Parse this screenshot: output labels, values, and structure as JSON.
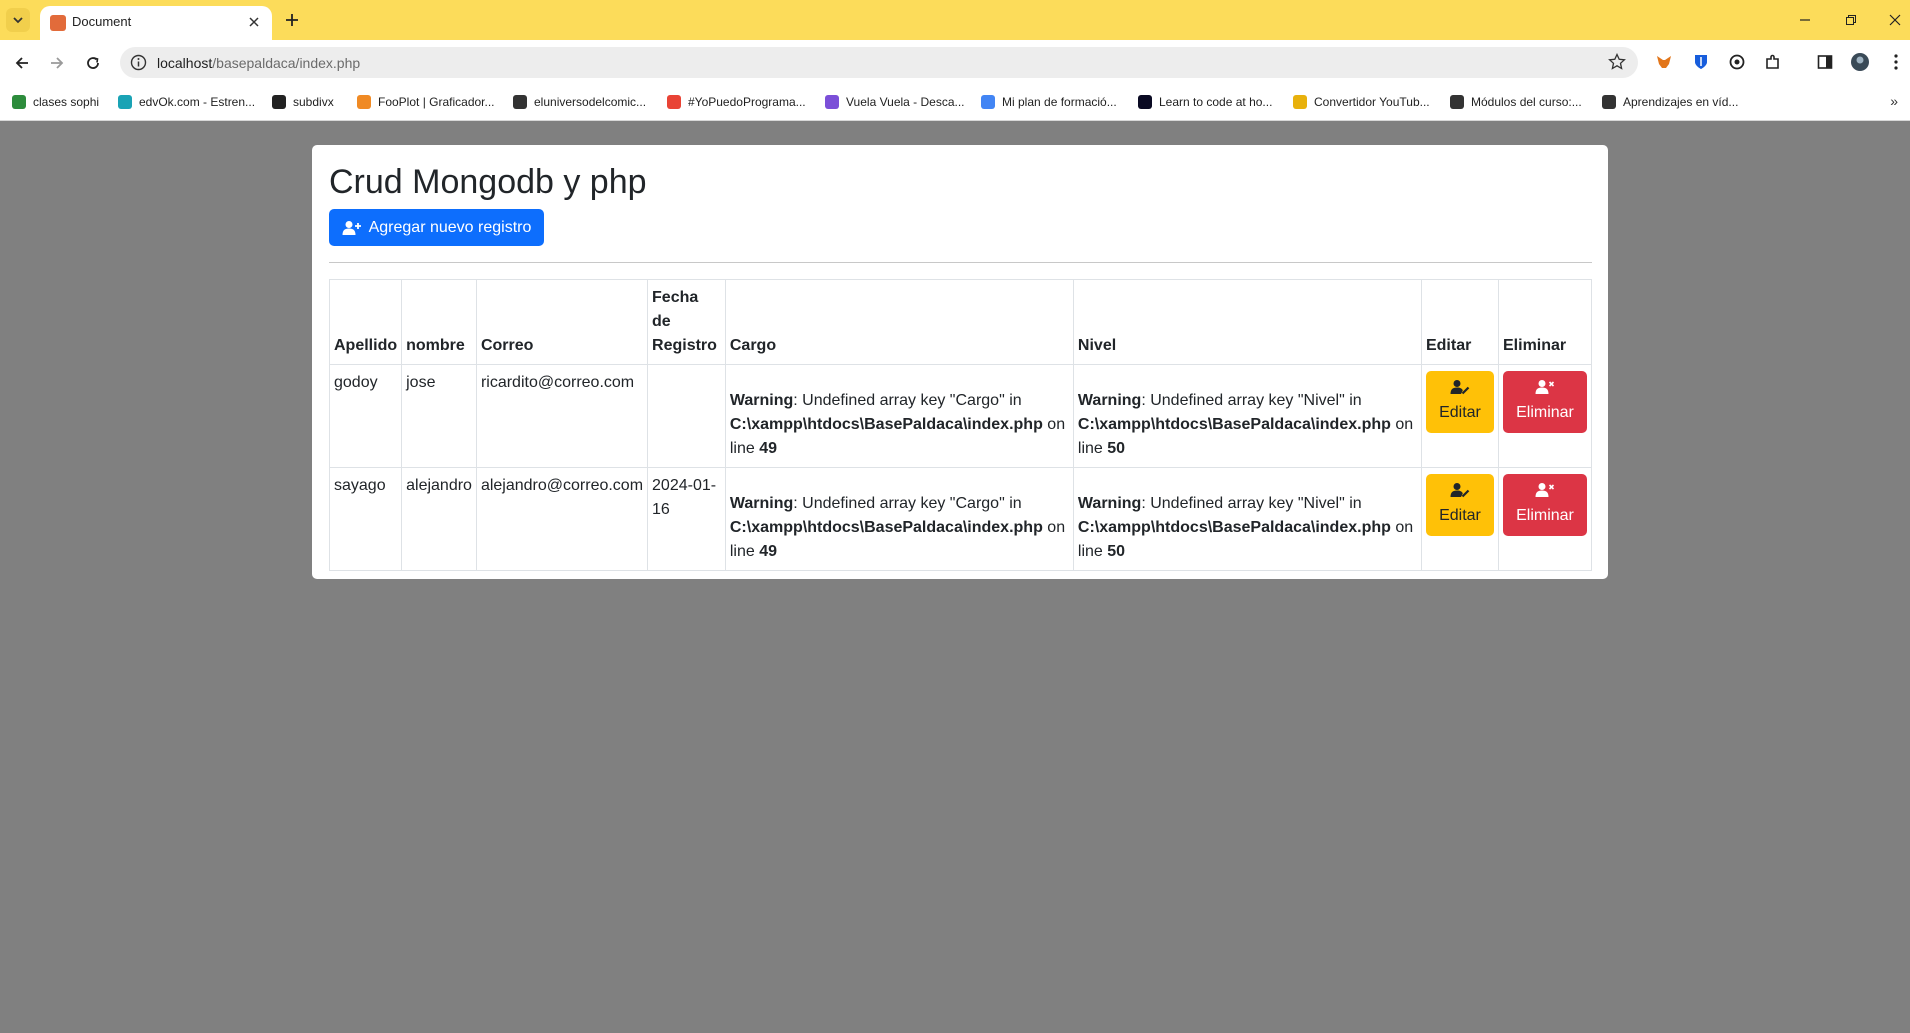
{
  "browser": {
    "tab_title": "Document",
    "url_host": "localhost",
    "url_path": "/basepaldaca/index.php",
    "bookmarks": [
      {
        "label": "clases sophi",
        "color": "#2d8c3c"
      },
      {
        "label": "edvOk.com - Estren...",
        "color": "#1aa3b5"
      },
      {
        "label": "subdivx",
        "color": "#222222"
      },
      {
        "label": "FooPlot | Graficador...",
        "color": "#f08a24"
      },
      {
        "label": "eluniversodelcomic...",
        "color": "#333333"
      },
      {
        "label": "#YoPuedoPrograma...",
        "color": "#e94335"
      },
      {
        "label": "Vuela Vuela - Desca...",
        "color": "#7b4fd8"
      },
      {
        "label": "Mi plan de formació...",
        "color": "#4285f4"
      },
      {
        "label": "Learn to code at ho...",
        "color": "#0a0a23"
      },
      {
        "label": "Convertidor YouTub...",
        "color": "#e8b10c"
      },
      {
        "label": "Módulos del curso:...",
        "color": "#333333"
      },
      {
        "label": "Aprendizajes en víd...",
        "color": "#333333"
      }
    ]
  },
  "page": {
    "title": "Crud Mongodb y php",
    "add_button": "Agregar nuevo registro",
    "table": {
      "headers": {
        "apellido": "Apellido",
        "nombre": "nombre",
        "correo": "Correo",
        "fecha": "Fecha de Registro",
        "cargo": "Cargo",
        "nivel": "Nivel",
        "editar": "Editar",
        "eliminar": "Eliminar"
      },
      "rows": [
        {
          "apellido": "godoy",
          "nombre": "jose",
          "correo": "ricardito@correo.com",
          "fecha": "",
          "cargo": {
            "label": "Warning",
            "msg": ": Undefined array key \"Cargo\" in ",
            "file": "C:\\xampp\\htdocs\\BasePaldaca\\index.php",
            "on_line": " on line ",
            "line": "49"
          },
          "nivel": {
            "label": "Warning",
            "msg": ": Undefined array key \"Nivel\" in ",
            "file": "C:\\xampp\\htdocs\\BasePaldaca\\index.php",
            "on_line": " on line ",
            "line": "50"
          },
          "edit_label": "Editar",
          "delete_label": "Eliminar"
        },
        {
          "apellido": "sayago",
          "nombre": "alejandro",
          "correo": "alejandro@correo.com",
          "fecha": "2024-01-16",
          "cargo": {
            "label": "Warning",
            "msg": ": Undefined array key \"Cargo\" in ",
            "file": "C:\\xampp\\htdocs\\BasePaldaca\\index.php",
            "on_line": " on line ",
            "line": "49"
          },
          "nivel": {
            "label": "Warning",
            "msg": ": Undefined array key \"Nivel\" in ",
            "file": "C:\\xampp\\htdocs\\BasePaldaca\\index.php",
            "on_line": " on line ",
            "line": "50"
          },
          "edit_label": "Editar",
          "delete_label": "Eliminar"
        }
      ]
    }
  }
}
